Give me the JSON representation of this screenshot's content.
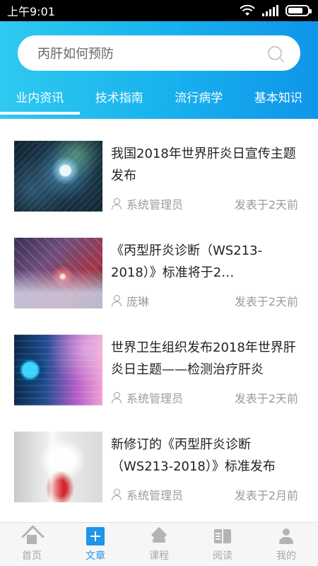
{
  "status_bar": {
    "time": "上午9:01",
    "icons": [
      "wifi-icon",
      "signal-icon",
      "battery-icon"
    ]
  },
  "header": {
    "search": {
      "placeholder": "丙肝如何预防",
      "icon": "search-icon"
    },
    "tabs": [
      {
        "label": "业内资讯",
        "active": true
      },
      {
        "label": "技术指南",
        "active": false
      },
      {
        "label": "流行病学",
        "active": false
      },
      {
        "label": "基本知识",
        "active": false
      }
    ]
  },
  "articles": [
    {
      "title": "我国2018年世界肝炎日宣传主题发布",
      "author": "系统管理员",
      "time": "发表于2天前"
    },
    {
      "title": "《丙型肝炎诊断（WS213-2018）》标准将于2…",
      "author": "庞琳",
      "time": "发表于2天前"
    },
    {
      "title": "世界卫生组织发布2018年世界肝炎日主题——检测治疗肝炎",
      "author": "系统管理员",
      "time": "发表于2天前"
    },
    {
      "title": "新修订的《丙型肝炎诊断（WS213-2018）》标准发布",
      "author": "系统管理员",
      "time": "发表于2月前"
    }
  ],
  "bottom_nav": [
    {
      "label": "首页",
      "icon": "home-icon",
      "active": false
    },
    {
      "label": "文章",
      "icon": "article-icon",
      "active": true
    },
    {
      "label": "课程",
      "icon": "layers-icon",
      "active": false
    },
    {
      "label": "阅读",
      "icon": "book-icon",
      "active": false
    },
    {
      "label": "我的",
      "icon": "user-icon",
      "active": false
    }
  ],
  "colors": {
    "accent": "#1f94e8",
    "header_start": "#2fc9f0",
    "header_end": "#0f95ea",
    "meta_text": "#9b9b9b"
  }
}
